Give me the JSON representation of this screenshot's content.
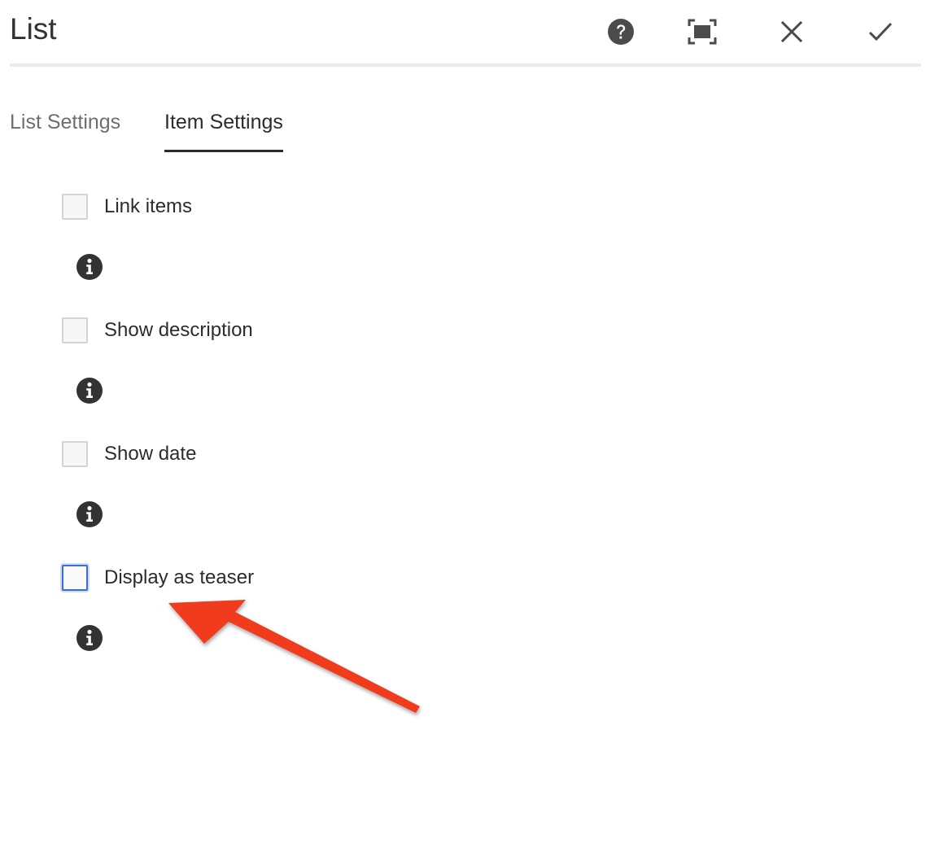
{
  "dialog": {
    "title": "List",
    "actions": {
      "help": "help-icon",
      "fullscreen": "fullscreen-icon",
      "cancel": "close-icon",
      "done": "checkmark-icon"
    }
  },
  "tabs": [
    {
      "label": "List Settings",
      "active": false
    },
    {
      "label": "Item Settings",
      "active": true
    }
  ],
  "fields": [
    {
      "label": "Link items",
      "checked": false
    },
    {
      "label": "Show description",
      "checked": false
    },
    {
      "label": "Show date",
      "checked": false
    },
    {
      "label": "Display as teaser",
      "checked": false,
      "focused": true
    }
  ],
  "colors": {
    "focus_border": "#3a6fd1",
    "annotation_arrow": "#f03a1f",
    "icon_dark": "#333333"
  }
}
